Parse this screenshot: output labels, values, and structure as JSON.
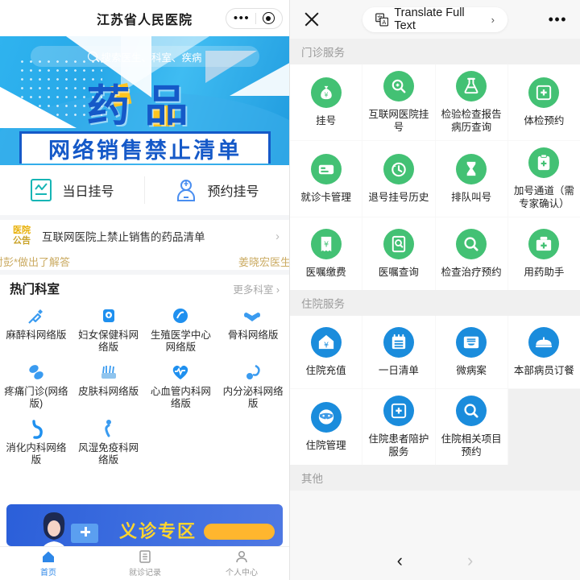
{
  "left": {
    "header": {
      "title": "江苏省人民医院",
      "menu_icon": "more-dots-icon",
      "target_icon": "target-icon"
    },
    "search": {
      "placeholder": "搜索医生、科室、疾病",
      "icon": "search-icon"
    },
    "banner": {
      "big_text": "药品",
      "sub_text": "网络销售禁止清单"
    },
    "quick_actions": [
      {
        "label": "当日挂号",
        "icon": "report-card-icon"
      },
      {
        "label": "预约挂号",
        "icon": "doctor-person-icon"
      }
    ],
    "notice": {
      "badge_line1": "医院",
      "badge_line2": "公告",
      "text": "互联网医院上禁止销售的药品清单",
      "arrow": "chevron-right-icon"
    },
    "ticker": {
      "left_text": "点医生对彭*做出了解答",
      "right_text": "姜晓宏医生对张*做"
    },
    "departments": {
      "title": "热门科室",
      "more_label": "更多科室",
      "items": [
        {
          "label": "麻醉科网络版",
          "icon": "syringe-icon"
        },
        {
          "label": "妇女保健科网络版",
          "icon": "female-health-icon"
        },
        {
          "label": "生殖医学中心网络版",
          "icon": "reproductive-icon"
        },
        {
          "label": "骨科网络版",
          "icon": "bone-icon"
        },
        {
          "label": "疼痛门诊(网络版)",
          "icon": "pills-icon"
        },
        {
          "label": "皮肤科网络版",
          "icon": "skin-icon"
        },
        {
          "label": "心血管内科网络版",
          "icon": "heart-pulse-icon"
        },
        {
          "label": "内分泌科网络版",
          "icon": "endocrine-icon"
        },
        {
          "label": "消化内科网络版",
          "icon": "stomach-icon"
        },
        {
          "label": "风湿免疫科网络版",
          "icon": "joint-icon"
        }
      ]
    },
    "bottom_banner": {
      "text": "义诊专区",
      "button_label": ""
    },
    "tabbar": [
      {
        "label": "首页",
        "icon": "home-icon",
        "active": true
      },
      {
        "label": "就诊记录",
        "icon": "records-icon",
        "active": false
      },
      {
        "label": "个人中心",
        "icon": "user-icon",
        "active": false
      }
    ]
  },
  "right": {
    "header": {
      "close_icon": "close-icon",
      "translate_label": "Translate Full Text",
      "translate_chevron": "›",
      "translate_icon": "translate-icon",
      "more_icon": "more-dots-icon"
    },
    "sections": [
      {
        "title": "门诊服务",
        "color": "#43c174",
        "items": [
          {
            "label": "挂号",
            "icon": "money-bag-icon"
          },
          {
            "label": "互联网医院挂号",
            "icon": "search-doc-icon"
          },
          {
            "label": "检验检查报告病历查询",
            "icon": "flask-icon"
          },
          {
            "label": "体检预约",
            "icon": "medical-file-icon"
          },
          {
            "label": "就诊卡管理",
            "icon": "card-icon"
          },
          {
            "label": "退号挂号历史",
            "icon": "clock-back-icon"
          },
          {
            "label": "排队叫号",
            "icon": "hourglass-icon"
          },
          {
            "label": "加号通道（需专家确认）",
            "icon": "clipboard-plus-icon"
          },
          {
            "label": "医嘱缴费",
            "icon": "receipt-yuan-icon"
          },
          {
            "label": "医嘱查询",
            "icon": "search-page-icon"
          },
          {
            "label": "检查治疗预约",
            "icon": "magnifier-icon"
          },
          {
            "label": "用药助手",
            "icon": "medicine-box-icon"
          }
        ]
      },
      {
        "title": "住院服务",
        "color": "#1a8cdc",
        "items": [
          {
            "label": "住院充值",
            "icon": "house-yuan-icon"
          },
          {
            "label": "一日清单",
            "icon": "calendar-list-icon"
          },
          {
            "label": "微病案",
            "icon": "archive-icon"
          },
          {
            "label": "本部病员订餐",
            "icon": "food-cover-icon"
          },
          {
            "label": "住院管理",
            "icon": "mask-face-icon"
          },
          {
            "label": "住院患者陪护服务",
            "icon": "medical-file-icon"
          },
          {
            "label": "住院相关项目预约",
            "icon": "magnifier-icon"
          }
        ]
      },
      {
        "title": "其他",
        "color": "#1a8cdc",
        "items": []
      }
    ],
    "nav": {
      "back": "‹",
      "forward": "›"
    }
  }
}
